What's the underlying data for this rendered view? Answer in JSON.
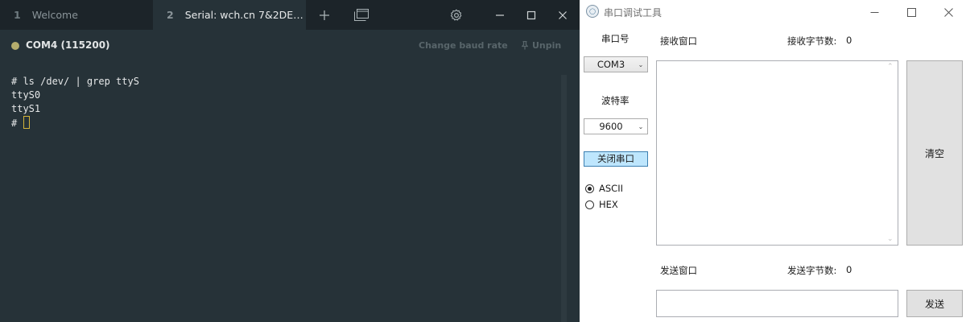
{
  "terminal_app": {
    "tabs": [
      {
        "number": "1",
        "title": "Welcome"
      },
      {
        "number": "2",
        "title": "Serial: wch.cn 7&2DE…"
      }
    ],
    "toolbar_icons": [
      "plus-icon",
      "split-window-icon",
      "gear-icon",
      "minimize-icon",
      "maximize-icon",
      "close-icon"
    ],
    "status": {
      "connection": "COM4 (115200)",
      "dot_color": "#b5ad6d",
      "change_baud_label": "Change baud rate",
      "unpin_label": "Unpin"
    },
    "terminal_lines": [
      "# ls /dev/ | grep ttyS",
      "ttyS0",
      "ttyS1",
      "# "
    ]
  },
  "serial_tool": {
    "title": "串口调试工具",
    "port_label": "串口号",
    "port_value": "COM3",
    "baud_label": "波特率",
    "baud_value": "9600",
    "close_port_button": "关闭串口",
    "encoding_options": [
      {
        "label": "ASCII",
        "selected": true
      },
      {
        "label": "HEX",
        "selected": false
      }
    ],
    "receive_label": "接收窗口",
    "receive_bytes_label": "接收字节数:",
    "receive_bytes_value": "0",
    "clear_button": "清空",
    "send_label": "发送窗口",
    "send_bytes_label": "发送字节数:",
    "send_bytes_value": "0",
    "send_button": "发送"
  },
  "colors": {
    "terminal_bg": "#263238",
    "tabbar_bg": "#1c2429",
    "cursor": "#d4b43a",
    "button_selected_bg": "#bee6fd"
  }
}
